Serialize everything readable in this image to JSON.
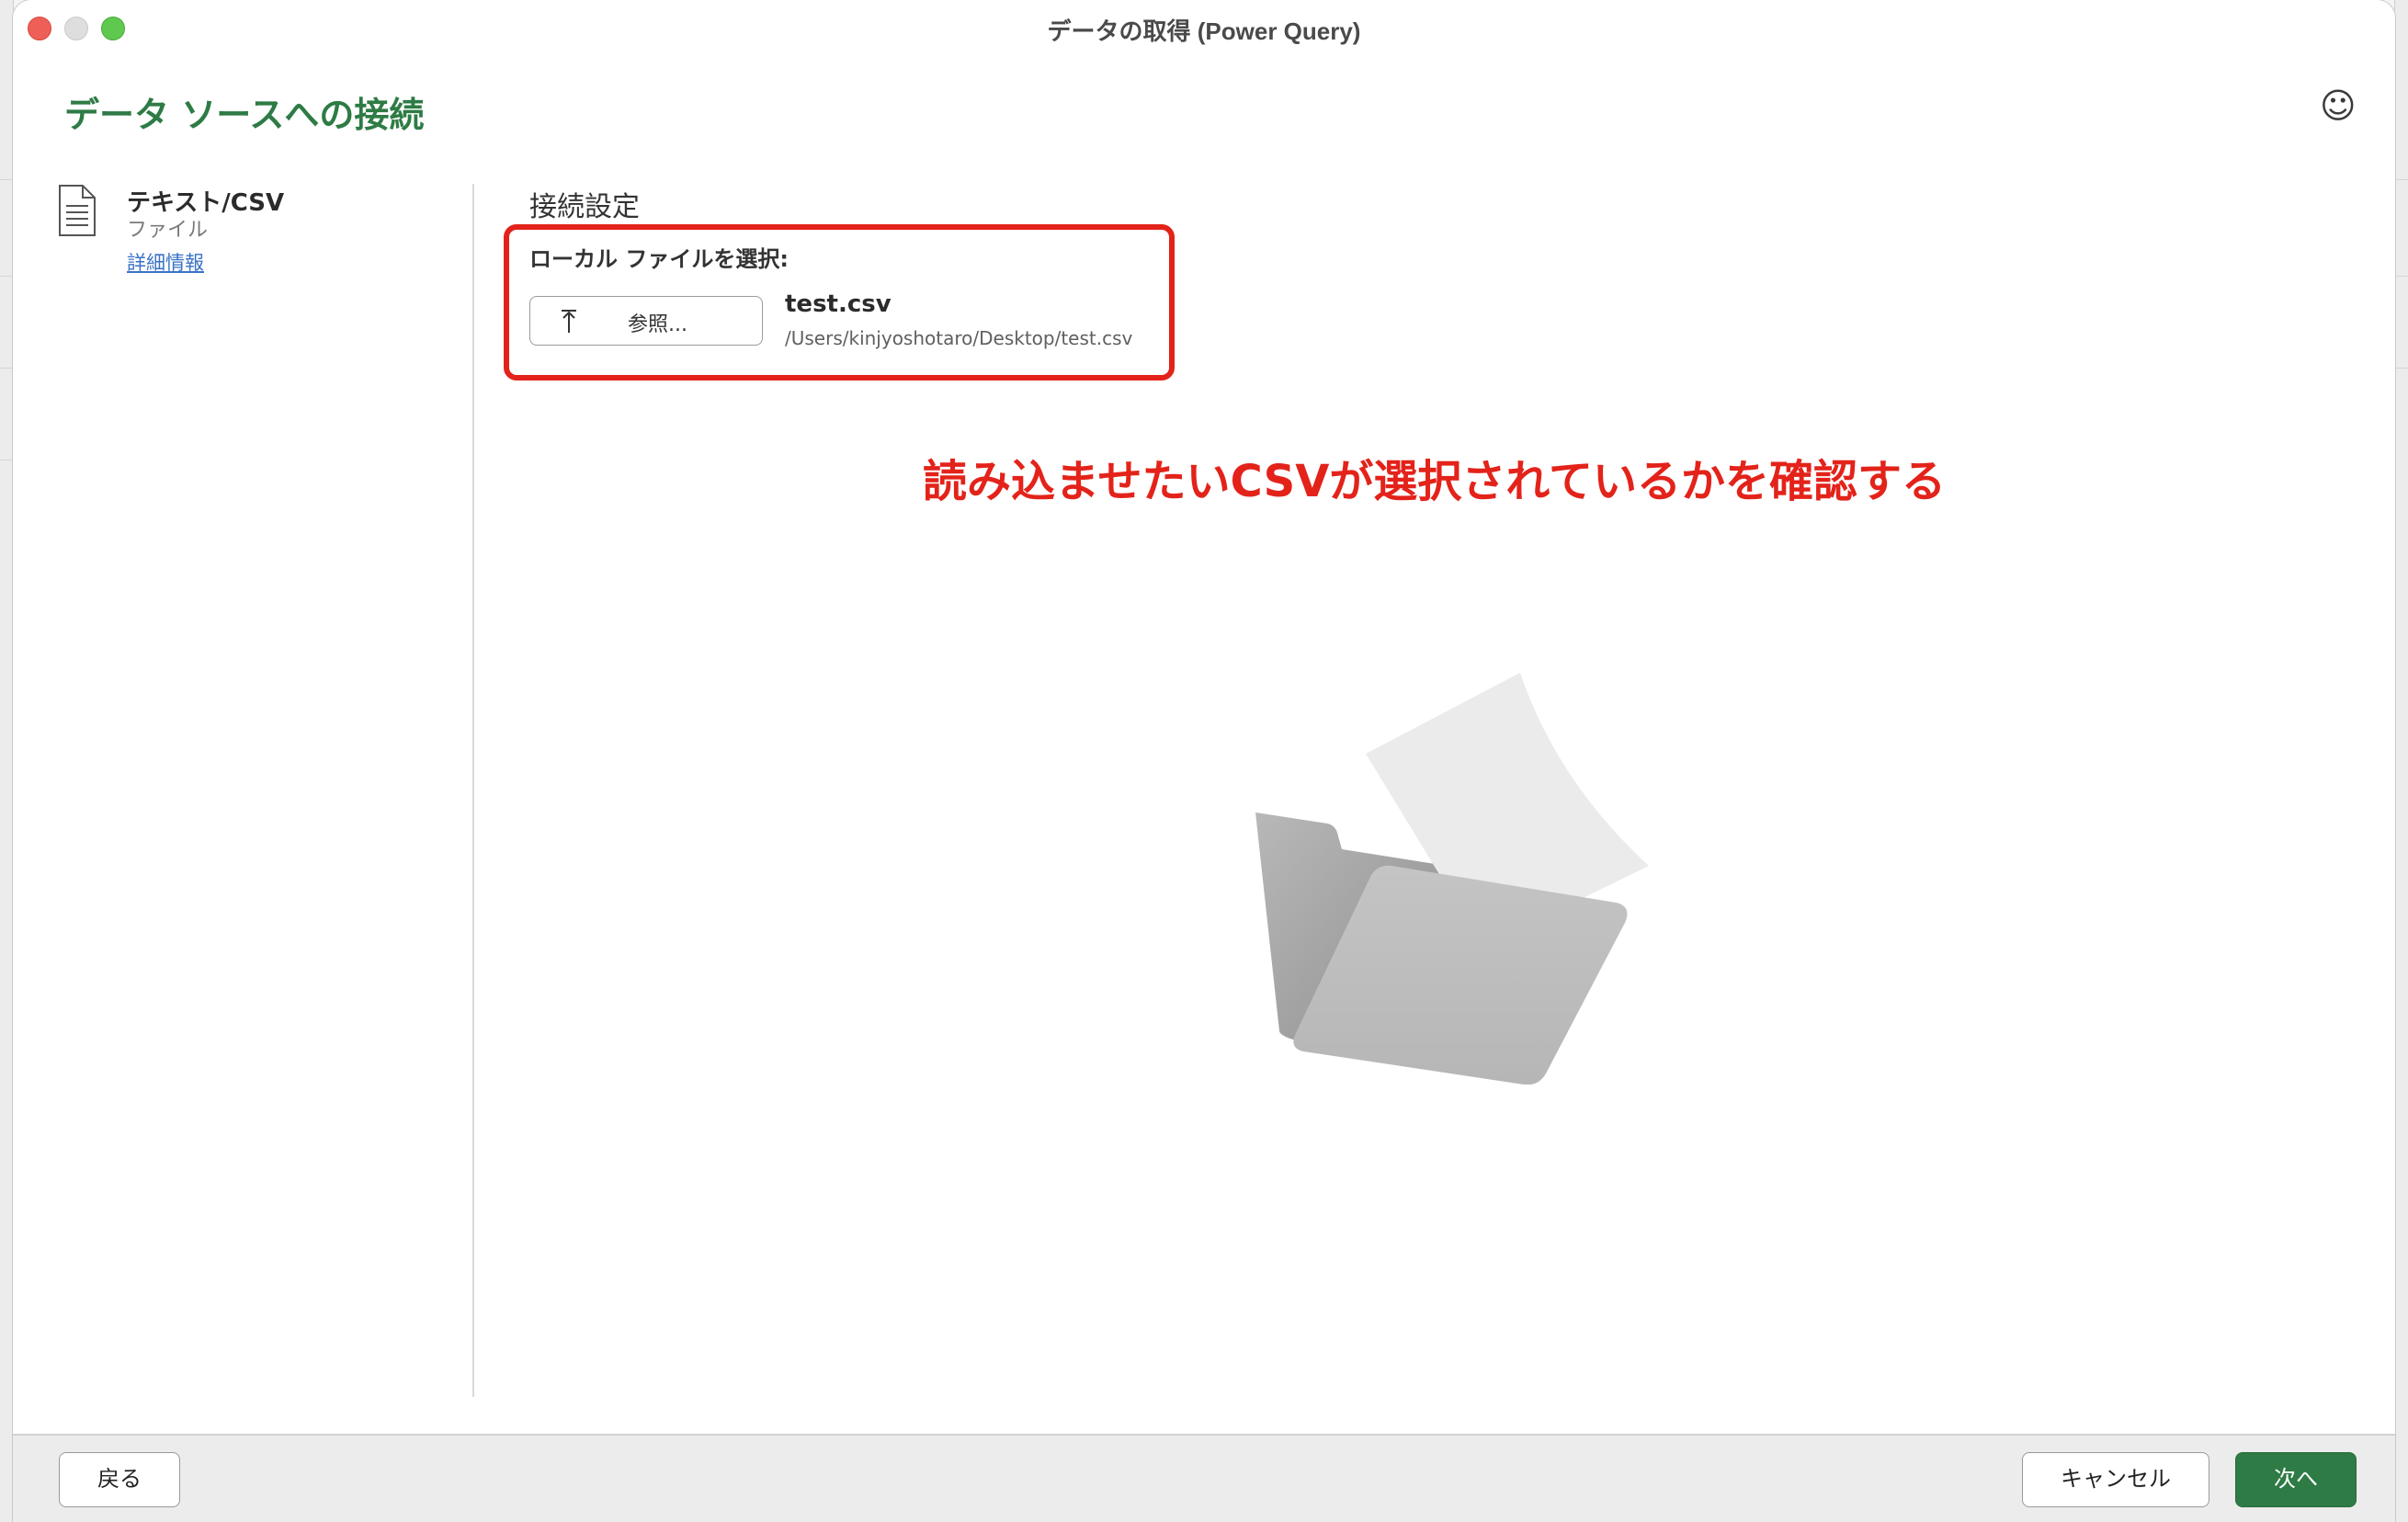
{
  "window": {
    "title": "データの取得 (Power Query)"
  },
  "dialog": {
    "heading": "データ ソースへの接続",
    "feedback_icon": "smiley-icon"
  },
  "source": {
    "name": "テキスト/CSV",
    "type": "ファイル",
    "details_link": "詳細情報",
    "icon": "document-icon"
  },
  "settings": {
    "title": "接続設定",
    "local_label": "ローカル ファイルを選択:",
    "browse_label": "参照...",
    "file_name": "test.csv",
    "file_path": "/Users/kinjyoshotaro/Desktop/test.csv"
  },
  "annotation": {
    "text": "読み込ませたいCSVが選択されているかを確認する",
    "color": "#e3231a"
  },
  "footer": {
    "back_label": "戻る",
    "cancel_label": "キャンセル",
    "next_label": "次へ"
  },
  "colors": {
    "accent": "#2e7b45",
    "link": "#3a72c6",
    "highlight": "#e3231a"
  }
}
